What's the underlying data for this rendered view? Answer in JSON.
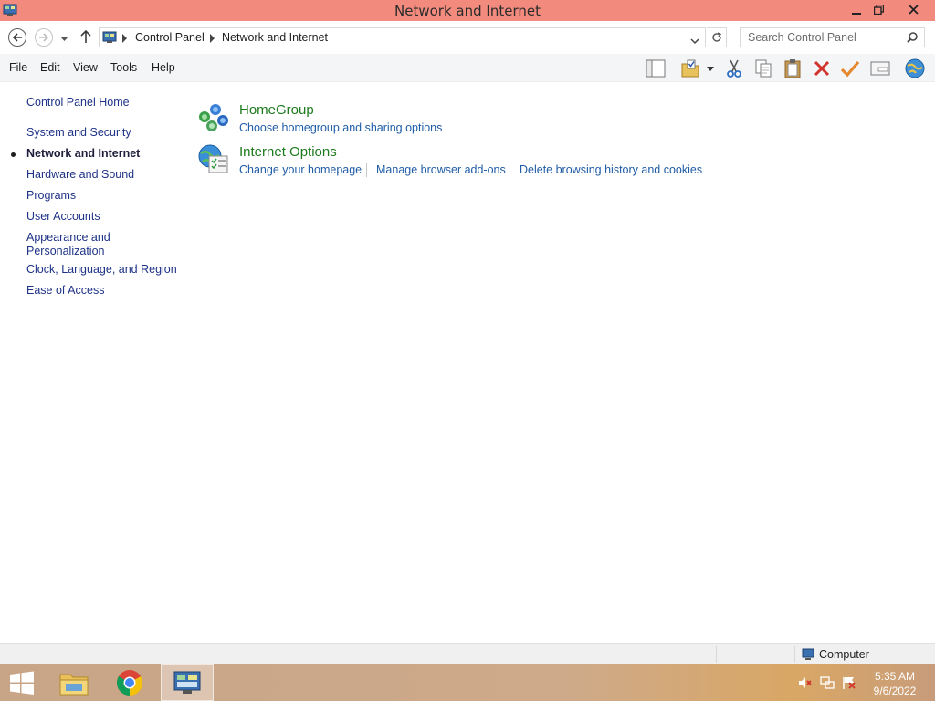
{
  "window": {
    "title": "Network and Internet"
  },
  "address": {
    "crumbs": [
      "Control Panel",
      "Network and Internet"
    ]
  },
  "search": {
    "placeholder": "Search Control Panel"
  },
  "menu": [
    "File",
    "Edit",
    "View",
    "Tools",
    "Help"
  ],
  "toolbar": [
    "layout-icon",
    "folder-check-icon",
    "cut-icon",
    "copy-icon",
    "paste-icon",
    "delete-icon",
    "checkmark-icon",
    "properties-icon",
    "globe-icon"
  ],
  "leftnav": {
    "home": "Control Panel Home",
    "items": [
      "System and Security",
      "Network and Internet",
      "Hardware and Sound",
      "Programs",
      "User Accounts",
      "Appearance and",
      "Personalization",
      "Clock, Language, and Region",
      "Ease of Access"
    ],
    "current": "Network and Internet"
  },
  "categories": [
    {
      "title": "HomeGroup",
      "icon": "homegroup-icon",
      "tasks": [
        "Choose homegroup and sharing options"
      ]
    },
    {
      "title": "Internet Options",
      "icon": "internet-options-icon",
      "tasks": [
        "Change your homepage",
        "Manage browser add-ons",
        "Delete browsing history and cookies"
      ]
    }
  ],
  "statusbar": {
    "zone": "Computer"
  },
  "taskbar": {
    "apps": [
      "windows-start-icon",
      "file-explorer-icon",
      "chrome-icon",
      "control-panel-icon"
    ],
    "tray": [
      "volume-muted-icon",
      "network-icon",
      "action-center-icon"
    ],
    "time": "5:35 AM",
    "date": "9/6/2022"
  },
  "colors": {
    "titlebar": "#f28b7e",
    "link": "#1f5ca6",
    "category": "#1e7a1e",
    "taskbar": "#ceaa8b"
  }
}
